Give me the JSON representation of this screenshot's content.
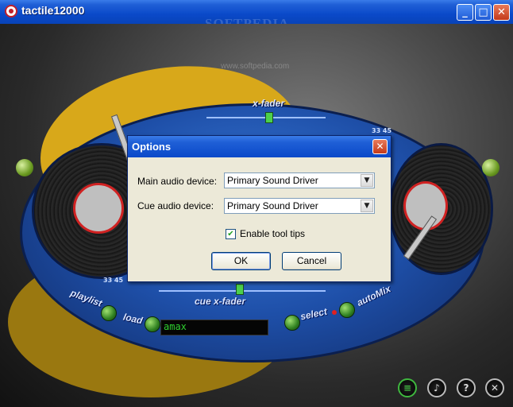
{
  "window": {
    "title": "tactile12000",
    "watermark": "SOFTPEDIA",
    "watermark_url": "www.softpedia.com",
    "controls": {
      "minimize": "_",
      "maximize": "□",
      "close": "✕"
    }
  },
  "mixer": {
    "xfader_label": "x-fader",
    "cue_xfader_label": "cue x-fader",
    "rpm_right": "33  45",
    "rpm_left": "33  45",
    "buttons": {
      "playlist": "playlist",
      "load": "load",
      "select": "select",
      "automix": "autoMix"
    },
    "lcd_text": "amax"
  },
  "bottom_bar": {
    "list": "≡",
    "note": "♪",
    "help": "?",
    "close": "✕"
  },
  "dialog": {
    "title": "Options",
    "close_label": "✕",
    "main_audio_label": "Main audio device:",
    "main_audio_value": "Primary Sound Driver",
    "cue_audio_label": "Cue audio device:",
    "cue_audio_value": "Primary Sound Driver",
    "tooltips_label": "Enable tool tips",
    "tooltips_checked": true,
    "ok_label": "OK",
    "cancel_label": "Cancel"
  },
  "colors": {
    "titlebar": "#0a49c9",
    "dialog_bg": "#ece9d8",
    "deck_blue": "#1e4fa8",
    "accent_yellow": "#d8a81a",
    "lcd_green": "#2fd02f"
  }
}
